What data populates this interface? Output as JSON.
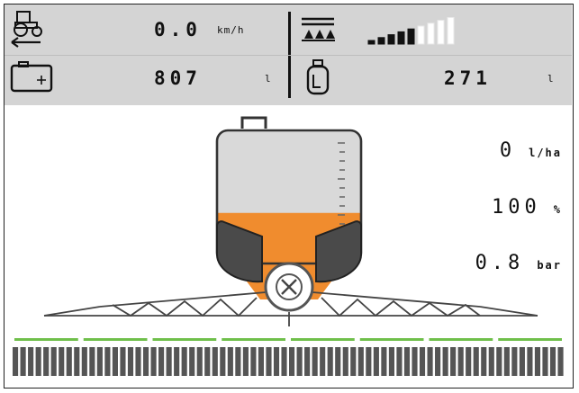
{
  "status": {
    "speed": {
      "value": "0.0",
      "unit": "km/h",
      "icon": "tractor-icon"
    },
    "signal": {
      "icon": "boom-nozzles-icon",
      "bars_filled": 5,
      "bars_total": 9
    },
    "tank_volume": {
      "value": "807",
      "unit": "l",
      "icon": "tank-icon"
    },
    "dosing": {
      "value": "271",
      "unit": "l",
      "icon": "sprayer-can-icon"
    }
  },
  "readouts": {
    "rate": {
      "value": "0",
      "unit": "l/ha"
    },
    "percent": {
      "value": "100",
      "unit": "%"
    },
    "pressure": {
      "value": "0.8",
      "unit": "bar"
    }
  },
  "tank": {
    "fill_fraction": 0.38
  },
  "boom": {
    "sections": 8,
    "active_sections": 8
  },
  "colors": {
    "accent": "#f08c2e",
    "panel": "#d4d4d4",
    "section_active": "#6fbf4b",
    "nozzle": "#555555"
  }
}
